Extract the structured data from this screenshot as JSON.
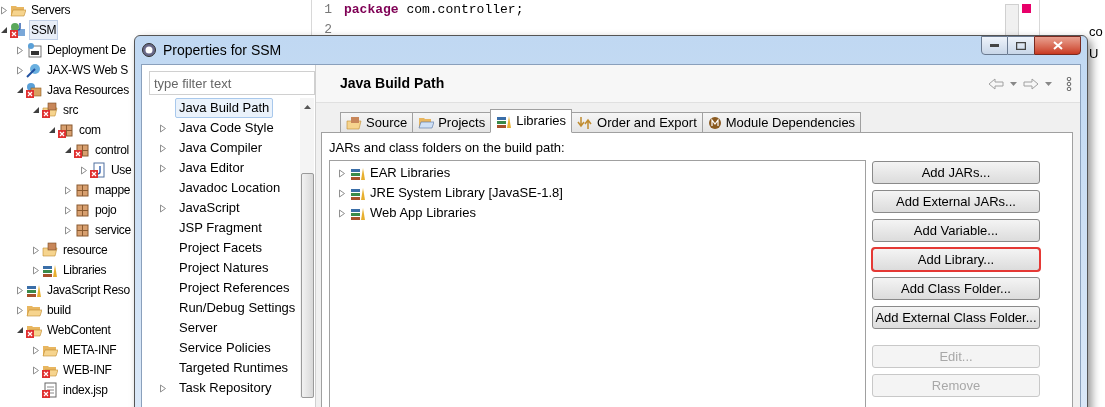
{
  "explorer": {
    "items": [
      {
        "label": "Servers",
        "kind": "folder",
        "has_children": true,
        "expanded": false,
        "error": false,
        "selected": false
      },
      {
        "label": "SSM",
        "kind": "project",
        "has_children": true,
        "expanded": true,
        "error": true,
        "selected": true,
        "children": [
          {
            "label": "Deployment De",
            "kind": "descriptor",
            "has_children": true,
            "expanded": false,
            "error": false,
            "selected": false
          },
          {
            "label": "JAX-WS Web S",
            "kind": "service",
            "has_children": true,
            "expanded": false,
            "error": false,
            "selected": false
          },
          {
            "label": "Java Resources",
            "kind": "resources",
            "has_children": true,
            "expanded": true,
            "error": true,
            "selected": false,
            "children": [
              {
                "label": "src",
                "kind": "source",
                "has_children": true,
                "expanded": true,
                "error": true,
                "selected": false,
                "children": [
                  {
                    "label": "com",
                    "kind": "package",
                    "has_children": true,
                    "expanded": true,
                    "error": true,
                    "selected": false,
                    "children": [
                      {
                        "label": "control",
                        "kind": "package",
                        "has_children": true,
                        "expanded": true,
                        "error": true,
                        "selected": false,
                        "children": [
                          {
                            "label": "Use",
                            "kind": "javafile",
                            "has_children": true,
                            "expanded": false,
                            "error": true,
                            "selected": false
                          }
                        ]
                      },
                      {
                        "label": "mappe",
                        "kind": "package",
                        "has_children": true,
                        "expanded": false,
                        "error": false,
                        "selected": false
                      },
                      {
                        "label": "pojo",
                        "kind": "package",
                        "has_children": true,
                        "expanded": false,
                        "error": false,
                        "selected": false
                      },
                      {
                        "label": "service",
                        "kind": "package",
                        "has_children": true,
                        "expanded": false,
                        "error": false,
                        "selected": false
                      }
                    ]
                  }
                ]
              },
              {
                "label": "resource",
                "kind": "source",
                "has_children": true,
                "expanded": false,
                "error": false,
                "selected": false
              },
              {
                "label": "Libraries",
                "kind": "library",
                "has_children": true,
                "expanded": false,
                "error": false,
                "selected": false
              }
            ]
          },
          {
            "label": "JavaScript Reso",
            "kind": "library",
            "has_children": true,
            "expanded": false,
            "error": false,
            "selected": false
          },
          {
            "label": "build",
            "kind": "folder",
            "has_children": true,
            "expanded": false,
            "error": false,
            "selected": false
          },
          {
            "label": "WebContent",
            "kind": "folder",
            "has_children": true,
            "expanded": true,
            "error": true,
            "selected": false,
            "children": [
              {
                "label": "META-INF",
                "kind": "folder",
                "has_children": true,
                "expanded": false,
                "error": false,
                "selected": false
              },
              {
                "label": "WEB-INF",
                "kind": "folder",
                "has_children": true,
                "expanded": false,
                "error": true,
                "selected": false
              },
              {
                "label": "index.jsp",
                "kind": "file",
                "has_children": false,
                "expanded": false,
                "error": true,
                "selected": false
              }
            ]
          }
        ]
      }
    ]
  },
  "editor": {
    "lines": [
      {
        "number": "1",
        "keyword": "package",
        "text": " com.controller;"
      },
      {
        "number": "2"
      }
    ]
  },
  "outline": {
    "texts": [
      "co",
      "U"
    ]
  },
  "dialog": {
    "title": "Properties for SSM",
    "filter": {
      "placeholder": "type filter text"
    },
    "pages": [
      {
        "label": "Java Build Path",
        "has_children": false,
        "selected": true
      },
      {
        "label": "Java Code Style",
        "has_children": true,
        "selected": false
      },
      {
        "label": "Java Compiler",
        "has_children": true,
        "selected": false
      },
      {
        "label": "Java Editor",
        "has_children": true,
        "selected": false
      },
      {
        "label": "Javadoc Location",
        "has_children": false,
        "selected": false
      },
      {
        "label": "JavaScript",
        "has_children": true,
        "selected": false
      },
      {
        "label": "JSP Fragment",
        "has_children": false,
        "selected": false
      },
      {
        "label": "Project Facets",
        "has_children": false,
        "selected": false
      },
      {
        "label": "Project Natures",
        "has_children": false,
        "selected": false
      },
      {
        "label": "Project References",
        "has_children": false,
        "selected": false
      },
      {
        "label": "Run/Debug Settings",
        "has_children": false,
        "selected": false
      },
      {
        "label": "Server",
        "has_children": false,
        "selected": false
      },
      {
        "label": "Service Policies",
        "has_children": false,
        "selected": false
      },
      {
        "label": "Targeted Runtimes",
        "has_children": false,
        "selected": false
      },
      {
        "label": "Task Repository",
        "has_children": true,
        "selected": false
      }
    ],
    "heading": "Java Build Path",
    "tabs": [
      {
        "label": "Source",
        "kind": "source",
        "selected": false
      },
      {
        "label": "Projects",
        "kind": "projects",
        "selected": false
      },
      {
        "label": "Libraries",
        "kind": "libraries",
        "selected": true
      },
      {
        "label": "Order and Export",
        "kind": "order",
        "selected": false
      },
      {
        "label": "Module Dependencies",
        "kind": "module",
        "selected": false
      }
    ],
    "caption": "JARs and class folders on the build path:",
    "libraries": [
      {
        "label": "EAR Libraries",
        "expanded": false
      },
      {
        "label": "JRE System Library [JavaSE-1.8]",
        "expanded": false
      },
      {
        "label": "Web App Libraries",
        "expanded": false
      }
    ],
    "buttons": [
      {
        "label": "Add JARs...",
        "disabled": false,
        "highlighted": false
      },
      {
        "label": "Add External JARs...",
        "disabled": false,
        "highlighted": false
      },
      {
        "label": "Add Variable...",
        "disabled": false,
        "highlighted": false
      },
      {
        "label": "Add Library...",
        "disabled": false,
        "highlighted": true
      },
      {
        "label": "Add Class Folder...",
        "disabled": false,
        "highlighted": false
      },
      {
        "label": "Add External Class Folder...",
        "disabled": false,
        "highlighted": false
      },
      {
        "label": "Edit...",
        "disabled": true,
        "highlighted": false
      },
      {
        "label": "Remove",
        "disabled": true,
        "highlighted": false
      }
    ]
  }
}
